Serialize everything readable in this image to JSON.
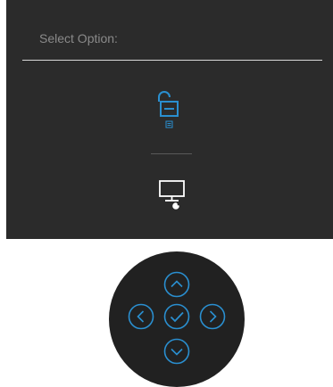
{
  "osd": {
    "title": "Select Option:",
    "options": [
      {
        "name": "menu-unlock",
        "icon": "unlock-menu-icon"
      },
      {
        "name": "display-diagnostics",
        "icon": "monitor-wrench-icon"
      }
    ]
  },
  "joystick": {
    "buttons": [
      {
        "name": "up",
        "icon": "chevron-up-icon"
      },
      {
        "name": "left",
        "icon": "chevron-left-icon"
      },
      {
        "name": "ok",
        "icon": "checkmark-icon"
      },
      {
        "name": "right",
        "icon": "chevron-right-icon"
      },
      {
        "name": "down",
        "icon": "chevron-down-icon"
      }
    ]
  },
  "colors": {
    "panel_bg": "#2b2b2b",
    "accent": "#2a8fd0",
    "icon_white": "#ffffff",
    "joystick_bg": "#212121"
  }
}
